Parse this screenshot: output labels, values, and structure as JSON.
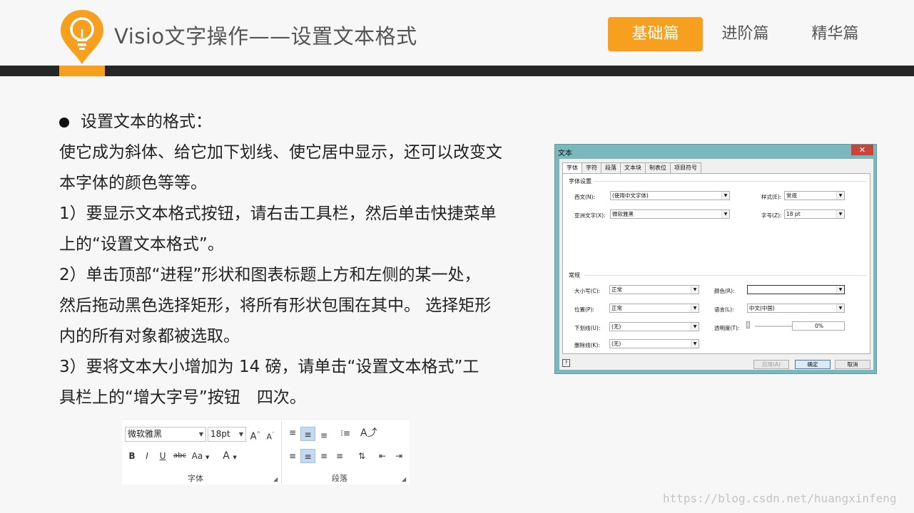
{
  "header": {
    "title": "Visio文字操作——设置文本格式",
    "nav": [
      "基础篇",
      "进阶篇",
      "精华篇"
    ],
    "active_nav": "基础篇",
    "accent_color": "#f7a020",
    "logo_icon": "lightbulb-icon"
  },
  "content": {
    "heading": "设置文本的格式：",
    "lines": [
      "使它成为斜体、给它加下划线、使它居中显示，还可以改变文",
      "本字体的颜色等等。",
      "1）要显示文本格式按钮，请右击工具栏，然后单击快捷菜单",
      "上的“设置文本格式”。",
      "2）单击顶部“进程”形状和图表标题上方和左侧的某一处，",
      "然后拖动黑色选择矩形，将所有形状包围在其中。 选择矩形",
      "内的所有对象都被选取。",
      "3）要将文本大小增加为 14 磅，请单击“设置文本格式”工",
      "具栏上的“增大字号”按钮　四次。"
    ]
  },
  "dialog": {
    "title": "文本",
    "close": "✕",
    "tabs": [
      "字体",
      "字符",
      "段落",
      "文本块",
      "制表位",
      "项目符号"
    ],
    "font_section": "字体设置",
    "western_label": "西文(N):",
    "western_value": "(使用中文字体)",
    "asian_label": "亚洲文字(X):",
    "asian_value": "微软雅黑",
    "style_label": "样式(E):",
    "style_value": "常规",
    "size_label": "字号(Z):",
    "size_value": "18 pt",
    "general_section": "常规",
    "case_label": "大小写(C):",
    "case_value": "正常",
    "position_label": "位置(P):",
    "position_value": "正常",
    "underline_label": "下划线(U):",
    "underline_value": "(无)",
    "strike_label": "删除线(K):",
    "strike_value": "(无)",
    "color_label": "颜色(R):",
    "lang_label": "语言(L):",
    "lang_value": "中文(中国)",
    "transparency_label": "透明度(T):",
    "transparency_value": "0%",
    "apply": "应用(A)",
    "ok": "确定",
    "cancel": "取消",
    "help": "?"
  },
  "ribbon": {
    "font_name": "微软雅黑",
    "font_size": "18pt",
    "font_group": "字体",
    "para_group": "段落",
    "bold": "B",
    "italic": "I",
    "underline": "U",
    "strike": "abc",
    "case": "Aa",
    "font_color": "A",
    "grow": "A",
    "shrink": "A"
  },
  "watermark": "https://blog.csdn.net/huangxinfeng"
}
